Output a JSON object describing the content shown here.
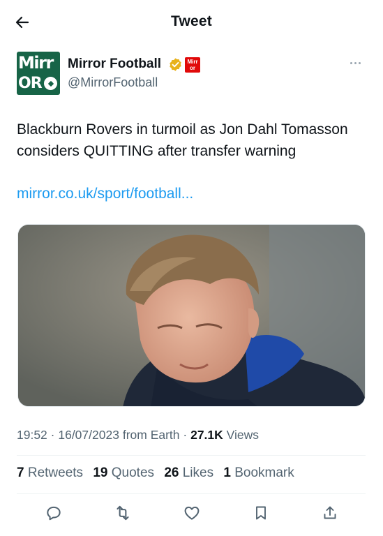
{
  "header": {
    "title": "Tweet",
    "back_icon": "arrow-left-icon"
  },
  "author": {
    "display_name": "Mirror Football",
    "handle": "@MirrorFootball",
    "avatar_text_top": "Mirr",
    "avatar_text_bottom": "OR",
    "affiliate_badge_text": "Mirr or",
    "verified_color": "#e8b21c",
    "avatar_color": "#176447"
  },
  "tweet": {
    "text": "Blackburn Rovers in turmoil as Jon Dahl Tomasson considers QUITTING after transfer warning",
    "link": "mirror.co.uk/sport/football..."
  },
  "meta": {
    "time": "19:52",
    "date": "16/07/2023",
    "source": "from Earth",
    "views_count": "27.1K",
    "views_label": "Views"
  },
  "stats": {
    "retweets_count": "7",
    "retweets_label": "Retweets",
    "quotes_count": "19",
    "quotes_label": "Quotes",
    "likes_count": "26",
    "likes_label": "Likes",
    "bookmarks_count": "1",
    "bookmarks_label": "Bookmark"
  },
  "actions": [
    "reply-icon",
    "retweet-icon",
    "like-icon",
    "bookmark-icon",
    "share-icon"
  ],
  "colors": {
    "link": "#1d9bf0",
    "muted": "#536471",
    "text": "#0f1419"
  }
}
